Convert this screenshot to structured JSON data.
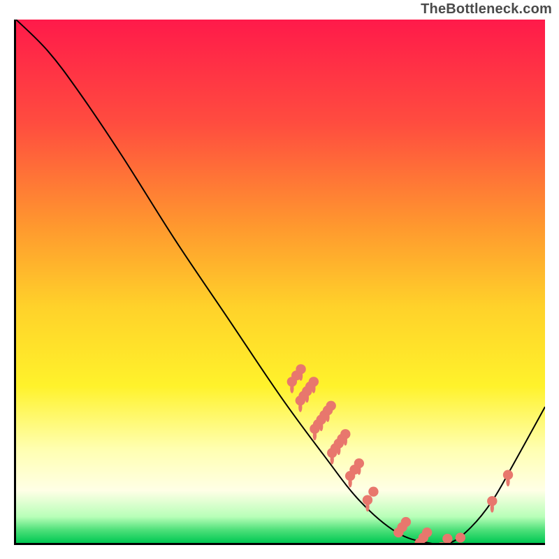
{
  "attribution": "TheBottleneck.com",
  "chart_data": {
    "type": "line",
    "title": "",
    "xlabel": "",
    "ylabel": "",
    "xlim": [
      0,
      100
    ],
    "ylim": [
      0,
      100
    ],
    "curve": [
      {
        "x": 0,
        "y": 100
      },
      {
        "x": 6,
        "y": 94
      },
      {
        "x": 12,
        "y": 86
      },
      {
        "x": 20,
        "y": 74
      },
      {
        "x": 30,
        "y": 58
      },
      {
        "x": 40,
        "y": 43
      },
      {
        "x": 50,
        "y": 28
      },
      {
        "x": 58,
        "y": 17
      },
      {
        "x": 65,
        "y": 8
      },
      {
        "x": 72,
        "y": 2
      },
      {
        "x": 78,
        "y": 0
      },
      {
        "x": 82,
        "y": 0
      },
      {
        "x": 86,
        "y": 3
      },
      {
        "x": 90,
        "y": 8
      },
      {
        "x": 94,
        "y": 15
      },
      {
        "x": 100,
        "y": 26
      }
    ],
    "marker_clusters": [
      {
        "x": 53,
        "y": 32,
        "count": 3,
        "spread": 1.2
      },
      {
        "x": 55,
        "y": 29,
        "count": 5,
        "spread": 1.8
      },
      {
        "x": 58,
        "y": 24,
        "count": 6,
        "spread": 2.2
      },
      {
        "x": 61,
        "y": 19,
        "count": 5,
        "spread": 1.8
      },
      {
        "x": 64,
        "y": 14,
        "count": 3,
        "spread": 1.2
      },
      {
        "x": 67,
        "y": 9,
        "count": 2,
        "spread": 0.8
      },
      {
        "x": 73,
        "y": 3,
        "count": 3,
        "spread": 1.0
      },
      {
        "x": 77,
        "y": 1,
        "count": 3,
        "spread": 1.0
      },
      {
        "x": 81,
        "y": 0,
        "count": 2,
        "spread": 0.8
      },
      {
        "x": 84,
        "y": 1,
        "count": 1,
        "spread": 0.5
      },
      {
        "x": 90,
        "y": 8,
        "count": 1,
        "spread": 0.5
      },
      {
        "x": 93,
        "y": 13,
        "count": 1,
        "spread": 0.5
      }
    ],
    "gradient_stops": [
      {
        "offset": 0,
        "color": "#ff1a4a"
      },
      {
        "offset": 0.2,
        "color": "#ff4d3f"
      },
      {
        "offset": 0.4,
        "color": "#ff9a2e"
      },
      {
        "offset": 0.55,
        "color": "#ffd22a"
      },
      {
        "offset": 0.7,
        "color": "#fff22b"
      },
      {
        "offset": 0.82,
        "color": "#ffffb0"
      },
      {
        "offset": 0.9,
        "color": "#ffffe6"
      },
      {
        "offset": 0.95,
        "color": "#b8ffb8"
      },
      {
        "offset": 0.975,
        "color": "#4fe07a"
      },
      {
        "offset": 1.0,
        "color": "#00c853"
      }
    ],
    "marker_color": "#e8776d",
    "curve_color": "#000000"
  }
}
